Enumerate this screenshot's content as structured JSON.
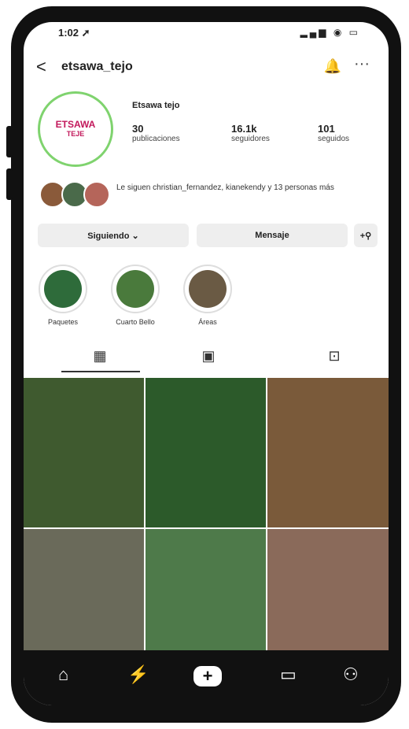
{
  "status_bar": {
    "time": "1:02 ➚",
    "icons": "▂▄▆ ◉ ▭"
  },
  "profile": {
    "back_label": "<",
    "username": "etsawa_tejo",
    "display_name": "Etsawa tejo",
    "avatar_logo_text": "ETSAWA",
    "avatar_logo_sub": "TEJE",
    "stats": [
      {
        "num": "30",
        "lbl": "publicaciones"
      },
      {
        "num": "16.1k",
        "lbl": "seguidores"
      },
      {
        "num": "101",
        "lbl": "seguidos"
      }
    ],
    "followed_by_text": "Le siguen christian_fernandez, kianekendy y 13 personas más"
  },
  "actions": {
    "following": "Siguiendo ⌄",
    "message": "Mensaje",
    "add_person": "+⚲"
  },
  "highlights": [
    {
      "label": "Paquetes",
      "color": "#2e6b3a"
    },
    {
      "label": "Cuarto Bello",
      "color": "#4a7a3c"
    },
    {
      "label": "Áreas",
      "color": "#6a5a44"
    }
  ],
  "tabs": [
    {
      "icon": "grid-icon",
      "glyph": "▦"
    },
    {
      "icon": "reels-icon",
      "glyph": "▣"
    },
    {
      "icon": "tagged-icon",
      "glyph": "⊡"
    }
  ],
  "grid_colors": [
    "#3f5a2f",
    "#2c5a2a",
    "#7a5a3a",
    "#6a6a5a",
    "#4e7a4a",
    "#8a6a5a"
  ],
  "bottom_nav": [
    {
      "icon": "home-icon",
      "glyph": "⌂"
    },
    {
      "icon": "reels-bolt-icon",
      "glyph": "⚡"
    },
    {
      "icon": "create-icon",
      "glyph": "+"
    },
    {
      "icon": "messages-icon",
      "glyph": "▭"
    },
    {
      "icon": "profile-icon",
      "glyph": "⚇"
    }
  ]
}
